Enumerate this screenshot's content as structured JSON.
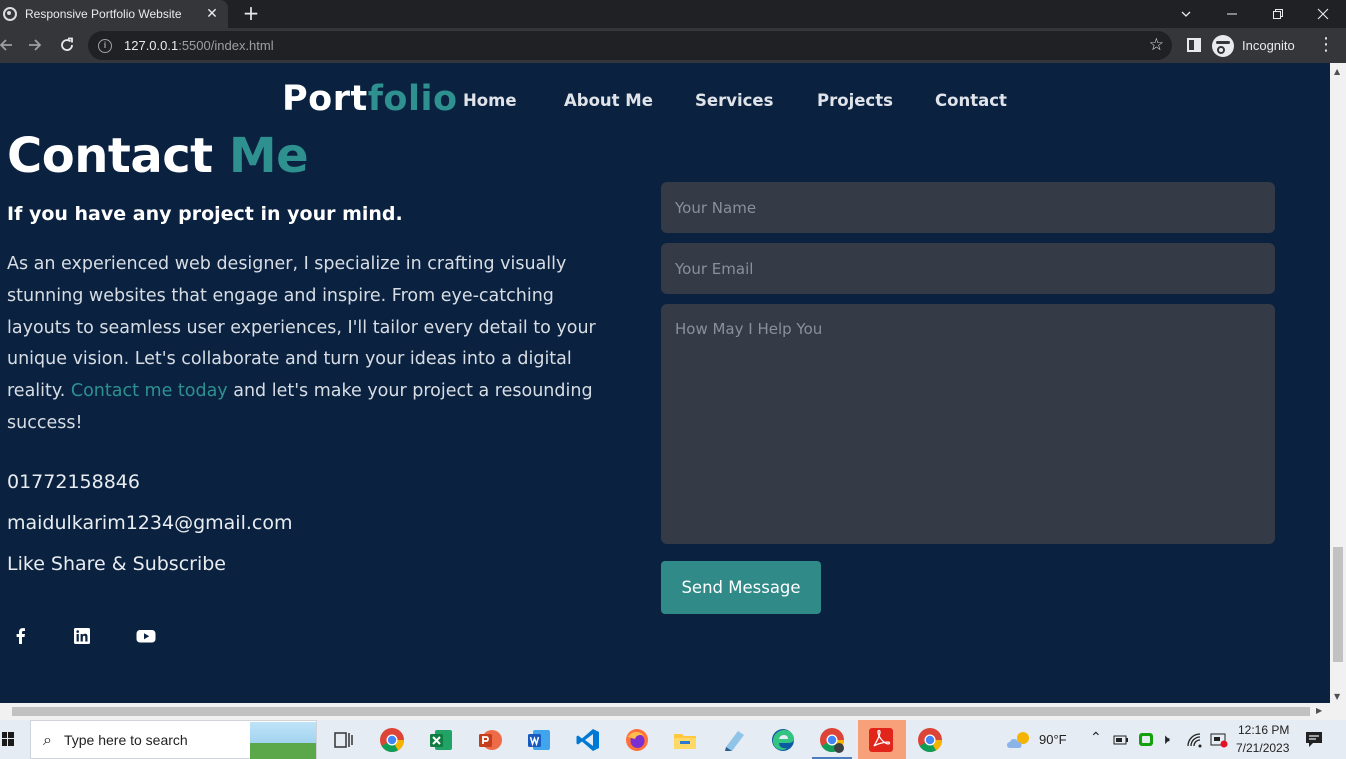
{
  "browser": {
    "tab_title": "Responsive Portfolio Website",
    "tab_close": "✕",
    "new_tab": "+",
    "url_host": "127.0.0.1",
    "url_rest": ":5500/index.html",
    "incognito_label": "Incognito"
  },
  "page": {
    "logo_main": "Port",
    "logo_accent": "folio",
    "nav": [
      "Home",
      "About Me",
      "Services",
      "Projects",
      "Contact"
    ],
    "heading_main": "Contact ",
    "heading_accent": "Me",
    "subheading": "If you have any project in your mind.",
    "paragraph_before": "As an experienced web designer, I specialize in crafting visually stunning websites that engage and inspire. From eye-catching layouts to seamless user experiences, I'll tailor every detail to your unique vision. Let's collaborate and turn your ideas into a digital reality. ",
    "paragraph_link": "Contact me today",
    "paragraph_after": " and let's make your project a resounding success!",
    "phone": "01772158846",
    "email": "maidulkarim1234@gmail.com",
    "social_label": "Like Share & Subscribe",
    "form": {
      "name_placeholder": "Your Name",
      "email_placeholder": "Your Email",
      "message_placeholder": "How May I Help You",
      "send_label": "Send Message"
    },
    "colors": {
      "background": "#0a2240",
      "accent": "#2f9090",
      "field": "#353a47"
    }
  },
  "taskbar": {
    "search_placeholder": "Type here to search",
    "weather": "90°F",
    "time": "12:16 PM",
    "date": "7/21/2023"
  }
}
